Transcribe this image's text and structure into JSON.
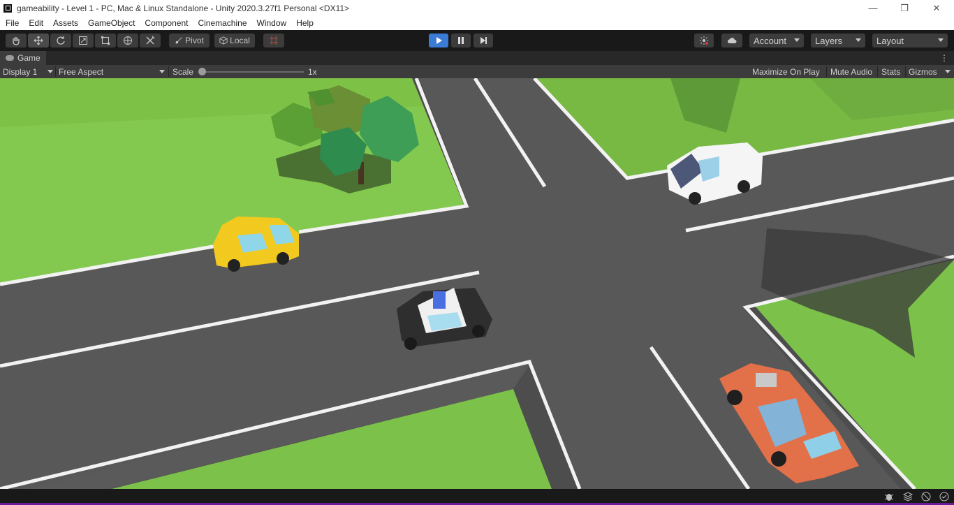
{
  "window": {
    "title": "gameability - Level 1 - PC, Mac & Linux Standalone - Unity 2020.3.27f1 Personal <DX11>",
    "controls": {
      "minimize": "—",
      "restore": "❐",
      "close": "✕"
    }
  },
  "menu": [
    "File",
    "Edit",
    "Assets",
    "GameObject",
    "Component",
    "Cinemachine",
    "Window",
    "Help"
  ],
  "toolbar": {
    "tools": [
      "hand-tool-icon",
      "move-tool-icon",
      "rotate-tool-icon",
      "scale-tool-icon",
      "rect-tool-icon",
      "transform-tool-icon",
      "custom-tool-icon"
    ],
    "pivot_label": "Pivot",
    "local_label": "Local",
    "account_label": "Account",
    "layers_label": "Layers",
    "layout_label": "Layout"
  },
  "tab": {
    "label": "Game"
  },
  "gamebar": {
    "display": "Display 1",
    "aspect": "Free Aspect",
    "scale_label": "Scale",
    "scale_value": "1x",
    "maximize_on_play": "Maximize On Play",
    "mute_audio": "Mute Audio",
    "stats": "Stats",
    "gizmos": "Gizmos"
  },
  "colors": {
    "accent": "#3a7bd5",
    "grass": "#7cc24a",
    "road": "#585858",
    "status_border": "#6a1b9a"
  }
}
